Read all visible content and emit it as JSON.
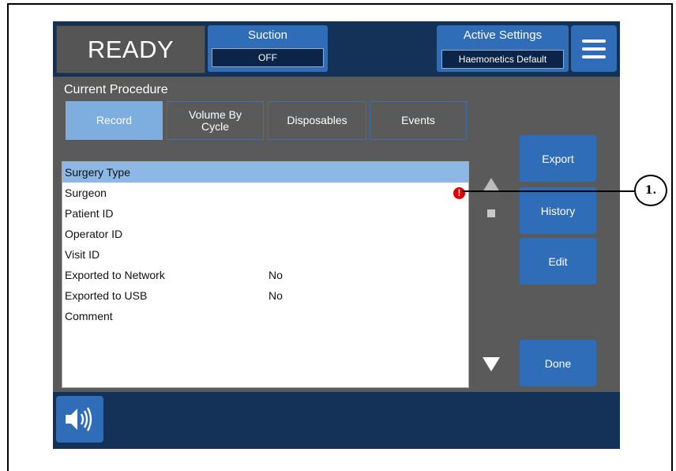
{
  "status": {
    "state": "READY"
  },
  "suction": {
    "title": "Suction",
    "value": "OFF"
  },
  "active_settings": {
    "title": "Active Settings",
    "value": "Haemonetics Default"
  },
  "procedure": {
    "title": "Current Procedure"
  },
  "tabs": [
    {
      "label": "Record",
      "selected": true
    },
    {
      "label": "Volume By\nCycle",
      "selected": false
    },
    {
      "label": "Disposables",
      "selected": false
    },
    {
      "label": "Events",
      "selected": false
    }
  ],
  "record_rows": [
    {
      "label": "Surgery Type",
      "value": "",
      "selected": true
    },
    {
      "label": "Surgeon",
      "value": "",
      "alert": true
    },
    {
      "label": "Patient ID",
      "value": ""
    },
    {
      "label": "Operator ID",
      "value": ""
    },
    {
      "label": "Visit ID",
      "value": ""
    },
    {
      "label": "Exported to Network",
      "value": "No"
    },
    {
      "label": "Exported to USB",
      "value": "No"
    },
    {
      "label": "Comment",
      "value": ""
    }
  ],
  "alert_icon": {
    "glyph": "!"
  },
  "side_buttons": {
    "export": "Export",
    "history": "History",
    "edit": "Edit",
    "done": "Done"
  },
  "icons": {
    "menu": "hamburger-menu-icon",
    "sound": "speaker-icon",
    "alert": "exclamation-icon",
    "scroll_up": "triangle-up-icon",
    "scroll_down": "triangle-down-icon"
  },
  "callout": {
    "label": "1."
  },
  "colors": {
    "accent": "#2f6db8",
    "bar": "#143257",
    "selected": "#8db8e6",
    "alert": "#e00000",
    "background": "#5a5a5a"
  }
}
